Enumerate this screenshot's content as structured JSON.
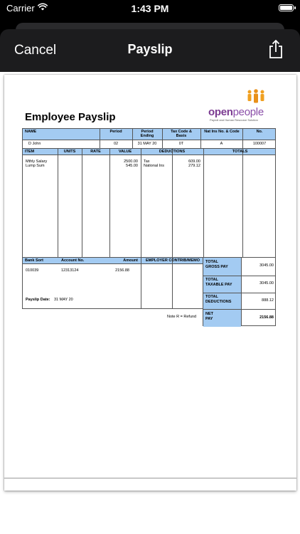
{
  "status_bar": {
    "carrier": "Carrier",
    "time": "1:43 PM"
  },
  "nav": {
    "cancel_label": "Cancel",
    "title": "Payslip"
  },
  "payslip": {
    "heading": "Employee Payslip",
    "logo": {
      "brand_open": "open",
      "brand_people": "people",
      "tagline": "Payroll and Human Resource Solution"
    },
    "info_headers": {
      "name": "NAME",
      "period": "Period",
      "period_ending": "Period Ending",
      "tax_code": "Tax Code & Basis",
      "ni_number": "Nat Ins No. & Code",
      "number": "No."
    },
    "info_values": {
      "name": "D John",
      "period": "02",
      "period_ending": "31 MAY 20",
      "tax_code": "0T",
      "ni_number": "A",
      "number": "100007"
    },
    "item_headers": {
      "item": "ITEM",
      "units": "UNITS",
      "rate": "RATE",
      "value": "VALUE",
      "deductions": "DEDUCTIONS",
      "totals": "TOTALS"
    },
    "items": [
      {
        "name": "Mthly Salary",
        "value": "2500.00"
      },
      {
        "name": "Lump Sum",
        "value": "545.00"
      }
    ],
    "deductions": [
      {
        "name": "Tax",
        "value": "609.00"
      },
      {
        "name": "National Ins",
        "value": "279.12"
      }
    ],
    "bank_headers": {
      "bank_sort": "Bank Sort",
      "account_no": "Account No.",
      "amount": "Amount",
      "employer_contrib": "EMPLOYER CONTRIB/MEMO"
    },
    "bank": {
      "sort": "010039",
      "account": "12313124",
      "amount": "2156.88"
    },
    "payslip_date_label": "Payslip Date:",
    "payslip_date": "31 MAY 20",
    "summary": {
      "total_gross_pay_l1": "TOTAL",
      "total_gross_pay_l2": "GROSS PAY",
      "total_gross_pay": "3045.00",
      "total_taxable_pay_l1": "TOTAL",
      "total_taxable_pay_l2": "TAXABLE PAY",
      "total_taxable_pay": "3045.00",
      "total_deductions_l1": "TOTAL",
      "total_deductions_l2": "DEDUCTIONS",
      "total_deductions": "888.12",
      "net_pay_l1": "NET",
      "net_pay_l2": "PAY",
      "net_pay": "2156.88"
    },
    "note": "Note R = Refund"
  },
  "colors": {
    "header_blue": "#a3cbf2",
    "brand_purple": "#7b3b91",
    "figure_orange": "#f0a020"
  },
  "icons": {
    "wifi": "wifi-icon",
    "battery": "battery-icon",
    "share": "share-icon"
  }
}
